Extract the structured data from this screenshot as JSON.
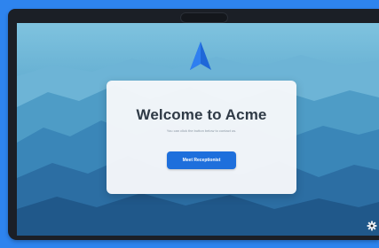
{
  "welcome": {
    "title": "Welcome to Acme",
    "subtitle": "You can click the button below to contact us.",
    "cta_label": "Meet Receptionist"
  },
  "icons": {
    "logo": "paper-plane-arrow-icon",
    "settings": "gear-icon"
  },
  "colors": {
    "frame_background": "#2e84ee",
    "button": "#1e6fdc",
    "logo": "#1f67d8",
    "title_text": "#2f3a46"
  }
}
